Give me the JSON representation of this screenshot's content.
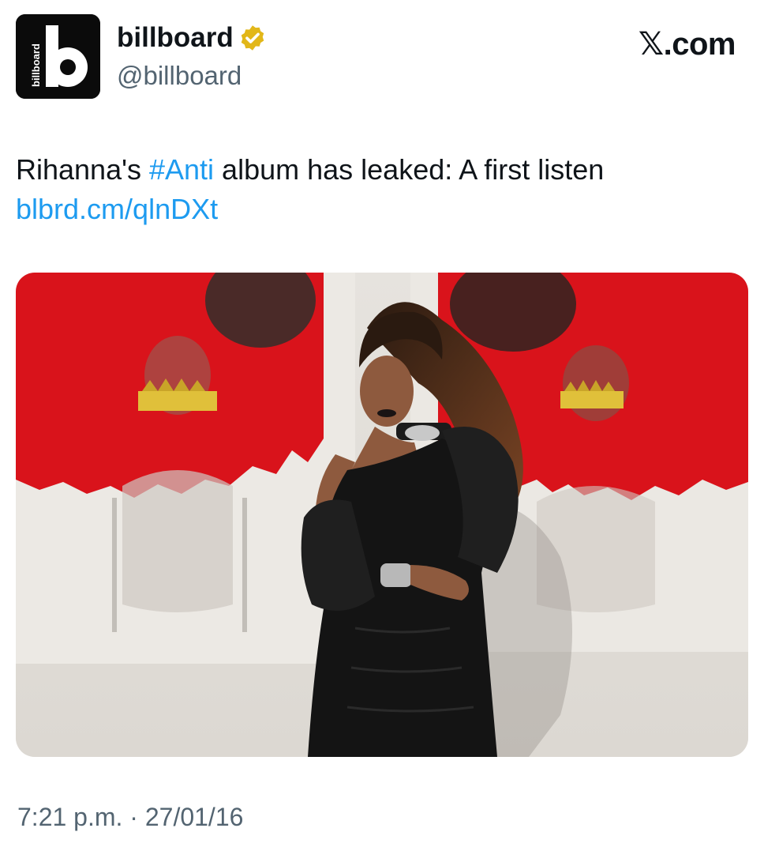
{
  "account": {
    "display_name": "billboard",
    "handle": "@billboard",
    "verified": true,
    "verified_badge_color": "#e2b719",
    "avatar_letter": "b",
    "avatar_wordmark": "billboard"
  },
  "site_label": "𝕏.com",
  "tweet": {
    "text_before": "Rihanna's ",
    "hashtag": "#Anti",
    "text_after": " album has leaked: A first listen",
    "link": "blbrd.cm/qlnDXt",
    "link_color": "#1d9bf0"
  },
  "media": {
    "kind": "photo",
    "description_icon": "photo-image"
  },
  "timestamp": "7:21 p.m. · 27/01/16"
}
